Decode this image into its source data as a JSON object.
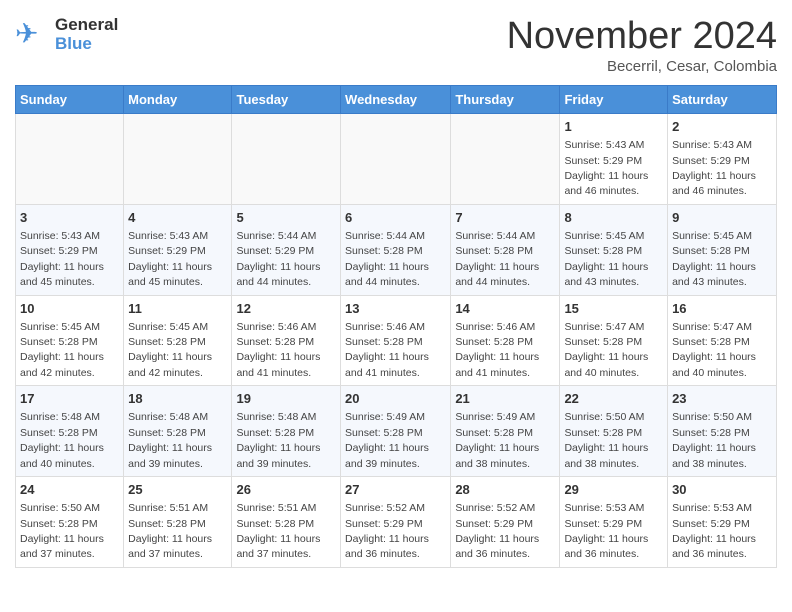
{
  "logo": {
    "general": "General",
    "blue": "Blue"
  },
  "header": {
    "month": "November 2024",
    "location": "Becerril, Cesar, Colombia"
  },
  "weekdays": [
    "Sunday",
    "Monday",
    "Tuesday",
    "Wednesday",
    "Thursday",
    "Friday",
    "Saturday"
  ],
  "weeks": [
    [
      {
        "day": "",
        "info": ""
      },
      {
        "day": "",
        "info": ""
      },
      {
        "day": "",
        "info": ""
      },
      {
        "day": "",
        "info": ""
      },
      {
        "day": "",
        "info": ""
      },
      {
        "day": "1",
        "info": "Sunrise: 5:43 AM\nSunset: 5:29 PM\nDaylight: 11 hours and 46 minutes."
      },
      {
        "day": "2",
        "info": "Sunrise: 5:43 AM\nSunset: 5:29 PM\nDaylight: 11 hours and 46 minutes."
      }
    ],
    [
      {
        "day": "3",
        "info": "Sunrise: 5:43 AM\nSunset: 5:29 PM\nDaylight: 11 hours and 45 minutes."
      },
      {
        "day": "4",
        "info": "Sunrise: 5:43 AM\nSunset: 5:29 PM\nDaylight: 11 hours and 45 minutes."
      },
      {
        "day": "5",
        "info": "Sunrise: 5:44 AM\nSunset: 5:29 PM\nDaylight: 11 hours and 44 minutes."
      },
      {
        "day": "6",
        "info": "Sunrise: 5:44 AM\nSunset: 5:28 PM\nDaylight: 11 hours and 44 minutes."
      },
      {
        "day": "7",
        "info": "Sunrise: 5:44 AM\nSunset: 5:28 PM\nDaylight: 11 hours and 44 minutes."
      },
      {
        "day": "8",
        "info": "Sunrise: 5:45 AM\nSunset: 5:28 PM\nDaylight: 11 hours and 43 minutes."
      },
      {
        "day": "9",
        "info": "Sunrise: 5:45 AM\nSunset: 5:28 PM\nDaylight: 11 hours and 43 minutes."
      }
    ],
    [
      {
        "day": "10",
        "info": "Sunrise: 5:45 AM\nSunset: 5:28 PM\nDaylight: 11 hours and 42 minutes."
      },
      {
        "day": "11",
        "info": "Sunrise: 5:45 AM\nSunset: 5:28 PM\nDaylight: 11 hours and 42 minutes."
      },
      {
        "day": "12",
        "info": "Sunrise: 5:46 AM\nSunset: 5:28 PM\nDaylight: 11 hours and 41 minutes."
      },
      {
        "day": "13",
        "info": "Sunrise: 5:46 AM\nSunset: 5:28 PM\nDaylight: 11 hours and 41 minutes."
      },
      {
        "day": "14",
        "info": "Sunrise: 5:46 AM\nSunset: 5:28 PM\nDaylight: 11 hours and 41 minutes."
      },
      {
        "day": "15",
        "info": "Sunrise: 5:47 AM\nSunset: 5:28 PM\nDaylight: 11 hours and 40 minutes."
      },
      {
        "day": "16",
        "info": "Sunrise: 5:47 AM\nSunset: 5:28 PM\nDaylight: 11 hours and 40 minutes."
      }
    ],
    [
      {
        "day": "17",
        "info": "Sunrise: 5:48 AM\nSunset: 5:28 PM\nDaylight: 11 hours and 40 minutes."
      },
      {
        "day": "18",
        "info": "Sunrise: 5:48 AM\nSunset: 5:28 PM\nDaylight: 11 hours and 39 minutes."
      },
      {
        "day": "19",
        "info": "Sunrise: 5:48 AM\nSunset: 5:28 PM\nDaylight: 11 hours and 39 minutes."
      },
      {
        "day": "20",
        "info": "Sunrise: 5:49 AM\nSunset: 5:28 PM\nDaylight: 11 hours and 39 minutes."
      },
      {
        "day": "21",
        "info": "Sunrise: 5:49 AM\nSunset: 5:28 PM\nDaylight: 11 hours and 38 minutes."
      },
      {
        "day": "22",
        "info": "Sunrise: 5:50 AM\nSunset: 5:28 PM\nDaylight: 11 hours and 38 minutes."
      },
      {
        "day": "23",
        "info": "Sunrise: 5:50 AM\nSunset: 5:28 PM\nDaylight: 11 hours and 38 minutes."
      }
    ],
    [
      {
        "day": "24",
        "info": "Sunrise: 5:50 AM\nSunset: 5:28 PM\nDaylight: 11 hours and 37 minutes."
      },
      {
        "day": "25",
        "info": "Sunrise: 5:51 AM\nSunset: 5:28 PM\nDaylight: 11 hours and 37 minutes."
      },
      {
        "day": "26",
        "info": "Sunrise: 5:51 AM\nSunset: 5:28 PM\nDaylight: 11 hours and 37 minutes."
      },
      {
        "day": "27",
        "info": "Sunrise: 5:52 AM\nSunset: 5:29 PM\nDaylight: 11 hours and 36 minutes."
      },
      {
        "day": "28",
        "info": "Sunrise: 5:52 AM\nSunset: 5:29 PM\nDaylight: 11 hours and 36 minutes."
      },
      {
        "day": "29",
        "info": "Sunrise: 5:53 AM\nSunset: 5:29 PM\nDaylight: 11 hours and 36 minutes."
      },
      {
        "day": "30",
        "info": "Sunrise: 5:53 AM\nSunset: 5:29 PM\nDaylight: 11 hours and 36 minutes."
      }
    ]
  ]
}
